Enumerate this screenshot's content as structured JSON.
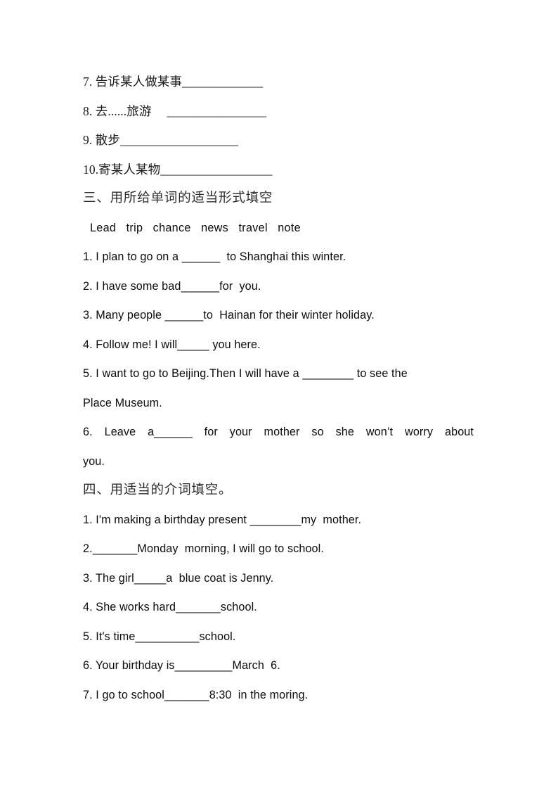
{
  "document": {
    "page_background": "#ffffff",
    "text_color": "#0c0c0c",
    "section_two_tail": {
      "items": [
        "7. 告诉某人做某事_____________",
        "8. 去......旅游　 ________________",
        "9. 散步___________________",
        "10.寄某人某物__________________"
      ]
    },
    "section_three": {
      "heading": "三、用所给单词的适当形式填空",
      "word_bank": "Lead   trip   chance   news   travel   note",
      "items": [
        "1. I plan to go on a ______  to Shanghai this winter.",
        "2. I have some bad______for  you.",
        "3. Many people ______to  Hainan for their winter holiday.",
        "4. Follow me! I will_____ you here.",
        "5. I want to go to Beijing.Then I will have a ________ to see the",
        "Place Museum.",
        "6. Leave a______ for your mother so she won’t worry about",
        "you."
      ]
    },
    "section_four": {
      "heading": "四、用适当的介词填空。",
      "items": [
        "1. I'm making a birthday present ________my  mother.",
        "2._______Monday  morning, I will go to school.",
        "3. The girl_____a  blue coat is Jenny.",
        "4. She works hard_______school.",
        "5. It's time__________school.",
        "6. Your birthday is_________March  6.",
        "7. I go to school_______8:30  in the moring."
      ]
    }
  }
}
